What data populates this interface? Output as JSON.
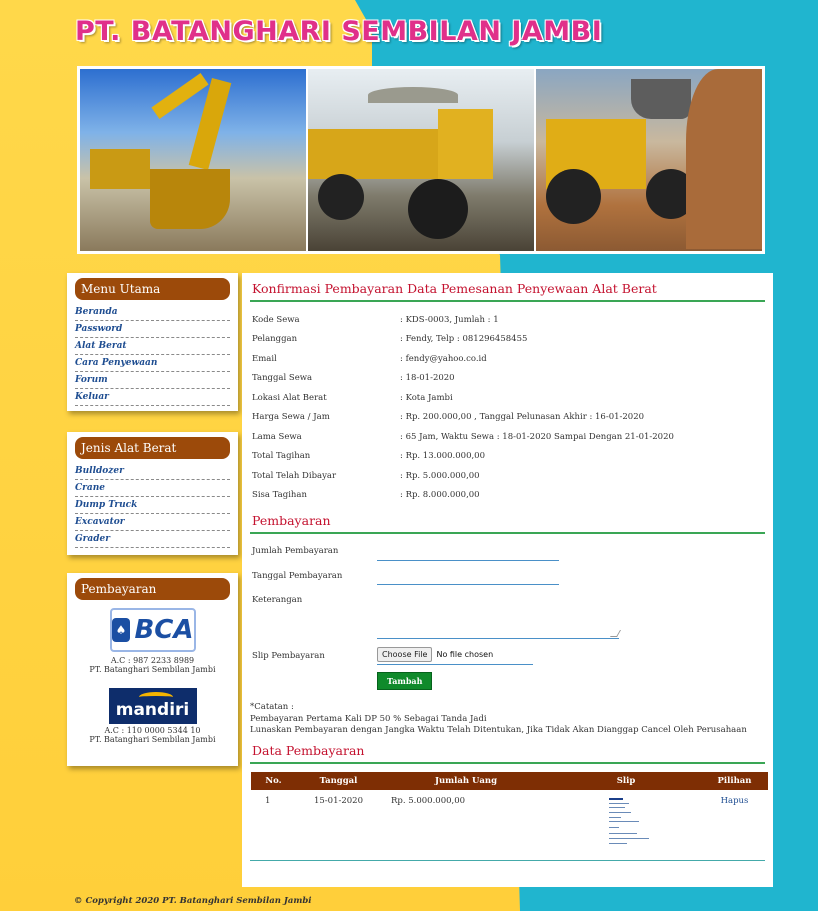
{
  "site": {
    "title": "PT. BATANGHARI SEMBILAN JAMBI",
    "copyright": "© Copyright 2020 PT. Batanghari Sembilan Jambi"
  },
  "sidebar": {
    "menu_utama": {
      "title": "Menu Utama",
      "items": [
        "Beranda",
        "Password",
        "Alat Berat",
        "Cara Penyewaan",
        "Forum",
        "Keluar"
      ]
    },
    "jenis_alat": {
      "title": "Jenis Alat Berat",
      "items": [
        "Bulldozer",
        "Crane",
        "Dump Truck",
        "Excavator",
        "Grader"
      ]
    },
    "pembayaran": {
      "title": "Pembayaran",
      "bca_logo": "BCA",
      "bca_account": "A.C : 987 2233 8989",
      "bca_name": "PT. Batanghari Sembilan Jambi",
      "mandiri_logo": "mandiri",
      "mandiri_account": "A.C : 110 0000 5344 10",
      "mandiri_name": "PT. Batanghari Sembilan Jambi"
    }
  },
  "main": {
    "title": "Konfirmasi Pembayaran Data Pemesanan Penyewaan Alat Berat",
    "info": [
      {
        "label": "Kode Sewa",
        "value": ": KDS-0003, Jumlah : 1"
      },
      {
        "label": "Pelanggan",
        "value": ": Fendy, Telp : 081296458455"
      },
      {
        "label": "Email",
        "value": ": fendy@yahoo.co.id"
      },
      {
        "label": "Tanggal Sewa",
        "value": ": 18-01-2020"
      },
      {
        "label": "Lokasi Alat Berat",
        "value": ": Kota Jambi"
      },
      {
        "label": "Harga Sewa / Jam",
        "value": ": Rp. 200.000,00 , Tanggal Pelunasan Akhir : 16-01-2020"
      },
      {
        "label": "Lama Sewa",
        "value": ": 65 Jam, Waktu Sewa : 18-01-2020 Sampai Dengan 21-01-2020"
      },
      {
        "label": "Total Tagihan",
        "value": ": Rp. 13.000.000,00"
      },
      {
        "label": "Total Telah Dibayar",
        "value": ": Rp. 5.000.000,00"
      },
      {
        "label": "Sisa Tagihan",
        "value": ": Rp. 8.000.000,00"
      }
    ],
    "payment_form": {
      "title": "Pembayaran",
      "jumlah_label": "Jumlah Pembayaran",
      "tanggal_label": "Tanggal Pembayaran",
      "keterangan_label": "Keterangan",
      "slip_label": "Slip Pembayaran",
      "file_button": "Choose File",
      "file_status": "No file chosen",
      "submit_label": "Tambah"
    },
    "notes": {
      "heading": "*Catatan :",
      "line1": "Pembayaran Pertama Kali DP 50 % Sebagai Tanda Jadi",
      "line2": "Lunaskan Pembayaran dengan Jangka Waktu Telah Ditentukan, Jika Tidak Akan Dianggap Cancel Oleh Perusahaan"
    },
    "data_pembayaran": {
      "title": "Data Pembayaran",
      "columns": [
        "No.",
        "Tanggal",
        "Jumlah Uang",
        "Slip",
        "Pilihan"
      ],
      "rows": [
        {
          "no": "1",
          "tanggal": "15-01-2020",
          "jumlah": "Rp. 5.000.000,00",
          "slip": "slip-thumbnail",
          "pilihan": "Hapus"
        }
      ]
    }
  },
  "colors": {
    "sidebar_header": "#9c4a0a",
    "title_red": "#c4122f",
    "divider_green": "#3aa655",
    "table_header": "#7e2e04",
    "link_blue": "#1e4d91",
    "button_green": "#0f8a2b",
    "bg_yellow": "#ffd84a",
    "bg_cyan": "#20b5cf"
  }
}
